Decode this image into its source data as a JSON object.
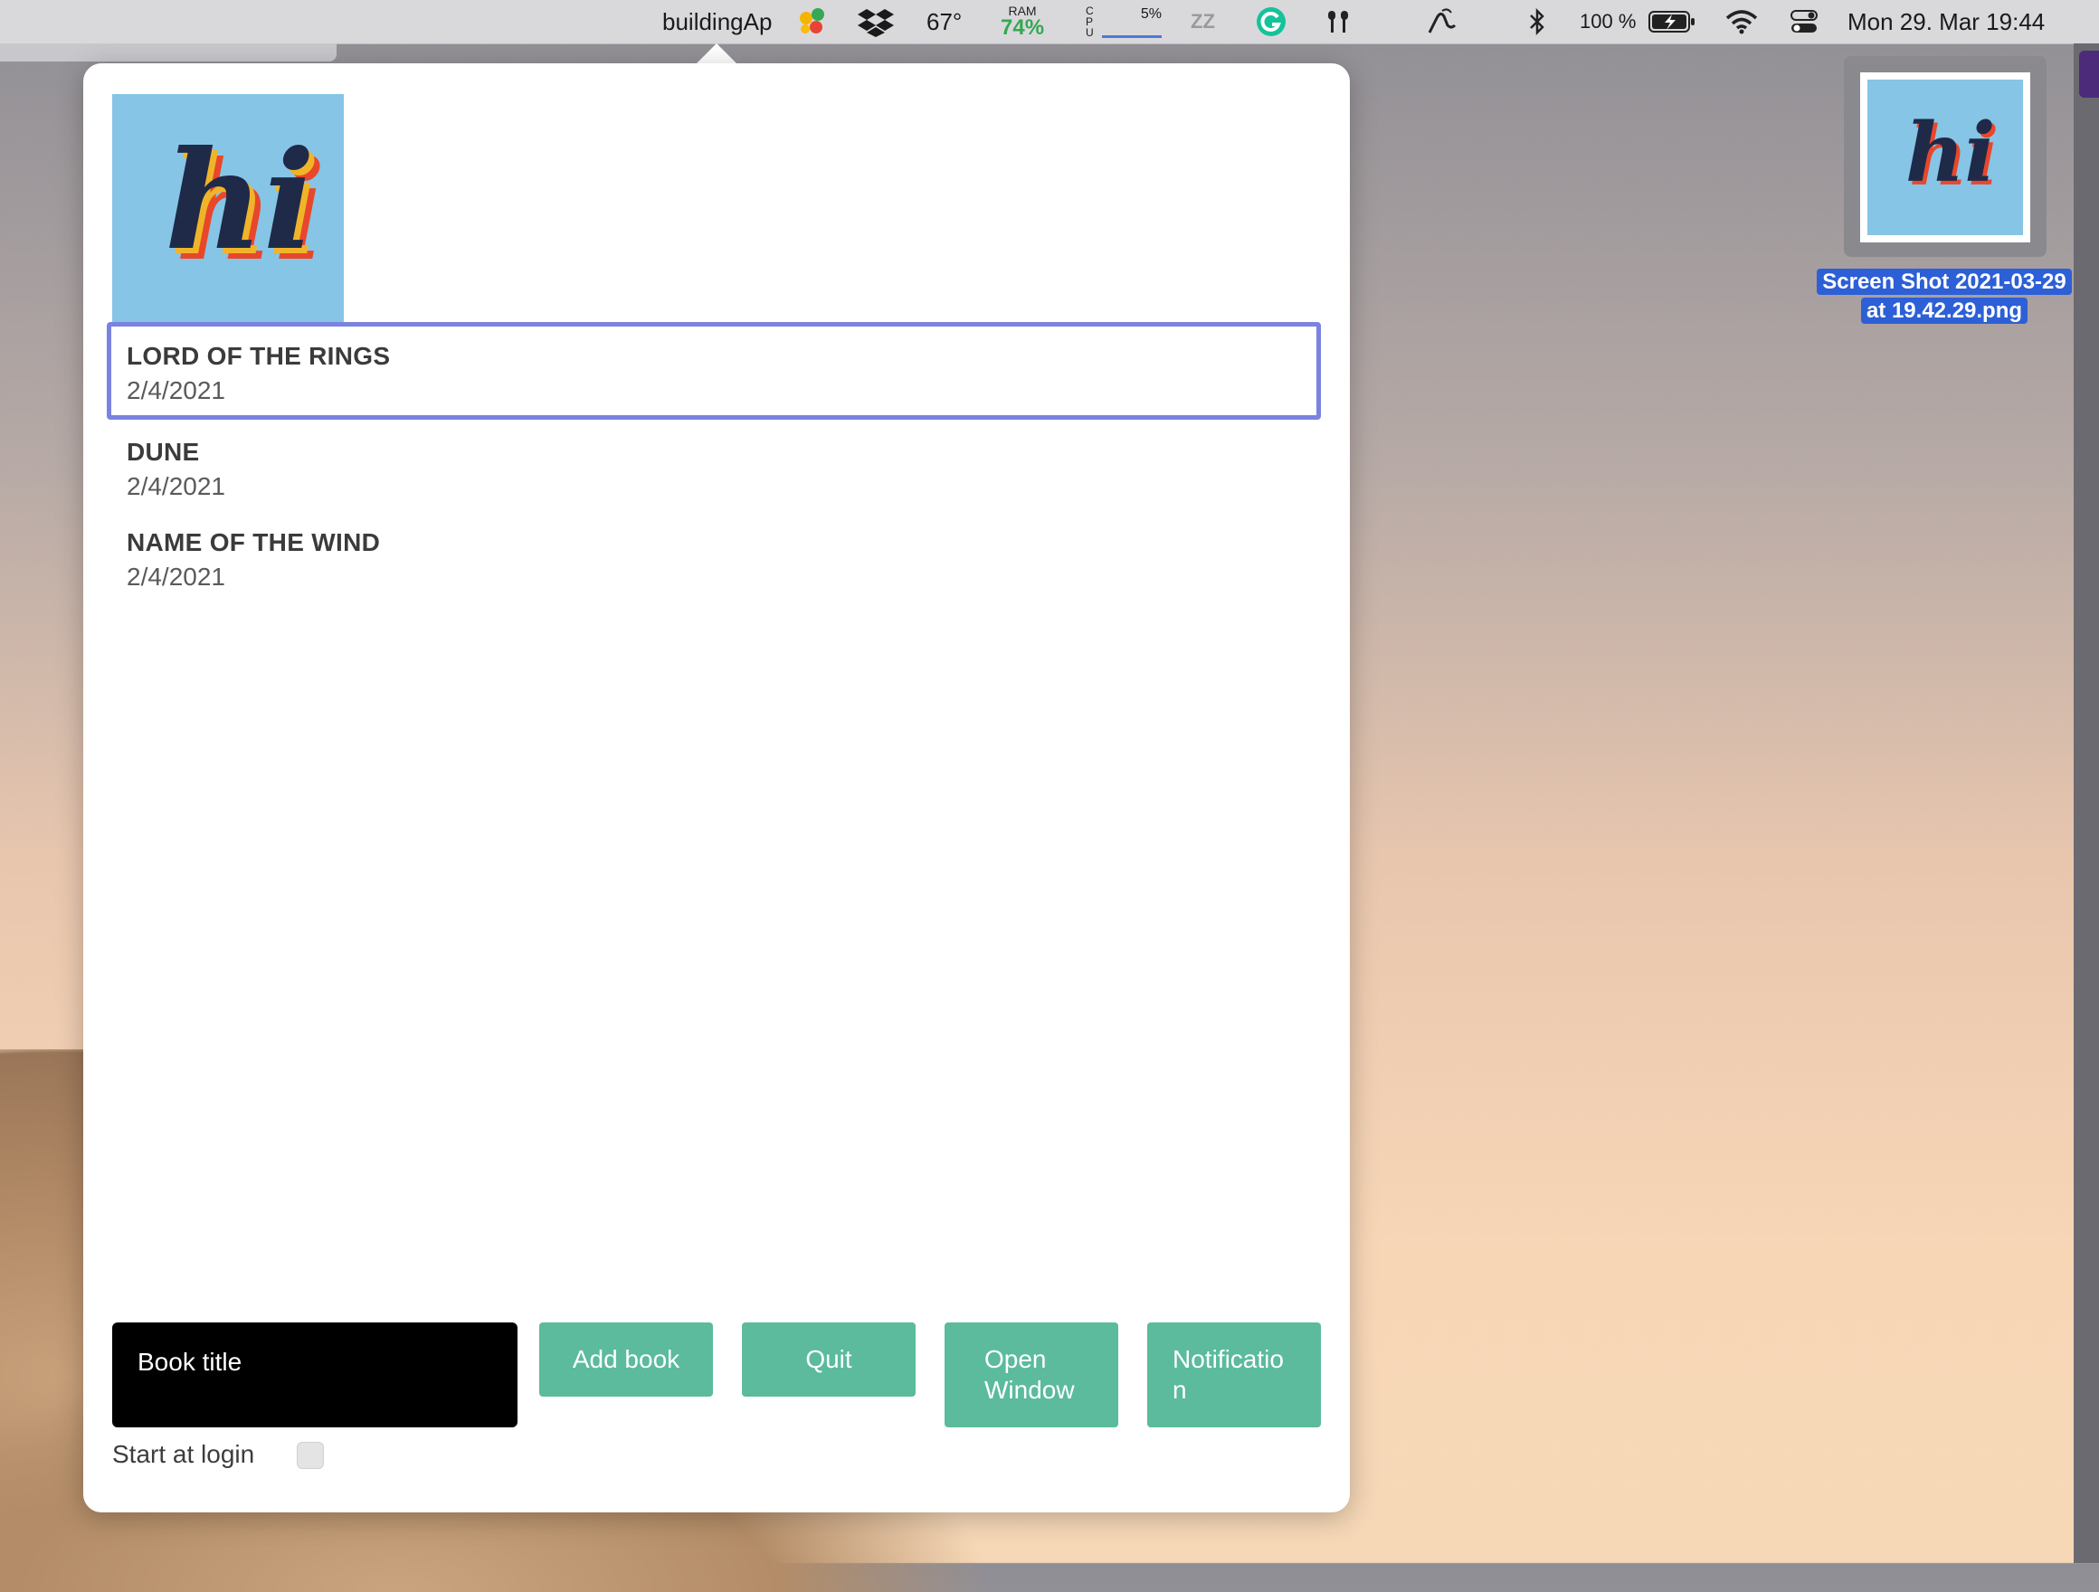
{
  "menubar": {
    "app_name": "buildingAp",
    "temperature": "67°",
    "ram_label": "RAM",
    "ram_value": "74%",
    "cpu_label": "C\nP\nU",
    "cpu_value": "5%",
    "sleep_glyph": "ZZ",
    "battery_percent": "100 %",
    "datetime": "Mon 29. Mar  19:44",
    "icons": [
      "colored-dots-icon",
      "dropbox-icon",
      "sleep-icon",
      "grammarly-icon",
      "airpods-icon",
      "gesture-icon",
      "bluetooth-icon",
      "battery-icon",
      "wifi-icon",
      "control-center-icon"
    ]
  },
  "panel": {
    "image_text": "hi",
    "books": [
      {
        "title": "LORD OF THE RINGS",
        "date": "2/4/2021",
        "selected": true
      },
      {
        "title": "DUNE",
        "date": "2/4/2021",
        "selected": false
      },
      {
        "title": "NAME OF THE WIND",
        "date": "2/4/2021",
        "selected": false
      }
    ],
    "input_placeholder": "Book title",
    "buttons": {
      "add": "Add book",
      "quit": "Quit",
      "open_window_l1": "Open",
      "open_window_l2": "Window",
      "notification_l1": "Notificatio",
      "notification_l2": "n"
    },
    "start_at_login": "Start at login"
  },
  "desktop": {
    "thumb_text": "hi",
    "file_label_l1": "Screen Shot 2021-03-29",
    "file_label_l2": "at 19.42.29.png"
  },
  "colors": {
    "accent_green": "#5bbb9c",
    "selection_border": "#7b82e0",
    "tile_blue": "#86c5e6",
    "file_label_bg": "#2d5fd6"
  }
}
